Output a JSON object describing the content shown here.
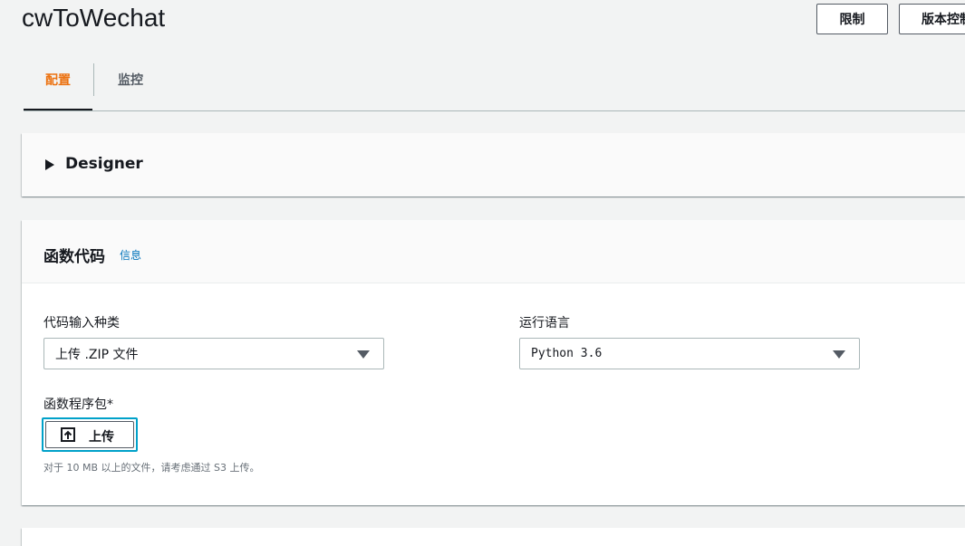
{
  "header": {
    "title": "cwToWechat",
    "limit_button": "限制",
    "version_button": "版本控制"
  },
  "tabs": [
    {
      "label": "配置",
      "active": true
    },
    {
      "label": "监控",
      "active": false
    }
  ],
  "designer": {
    "title": "Designer",
    "icon": "caret-right-icon"
  },
  "function_code": {
    "title": "函数代码",
    "info_link": "信息",
    "code_entry_label": "代码输入种类",
    "code_entry_value": "上传 .ZIP 文件",
    "runtime_label": "运行语言",
    "runtime_value": "Python 3.6",
    "package_label": "函数程序包*",
    "upload_button": "上传",
    "upload_hint": "对于 10 MB 以上的文件，请考虑通过 S3 上传。"
  },
  "colors": {
    "accent": "#ec7211",
    "link": "#0073bb",
    "focus": "#00a1c9"
  }
}
